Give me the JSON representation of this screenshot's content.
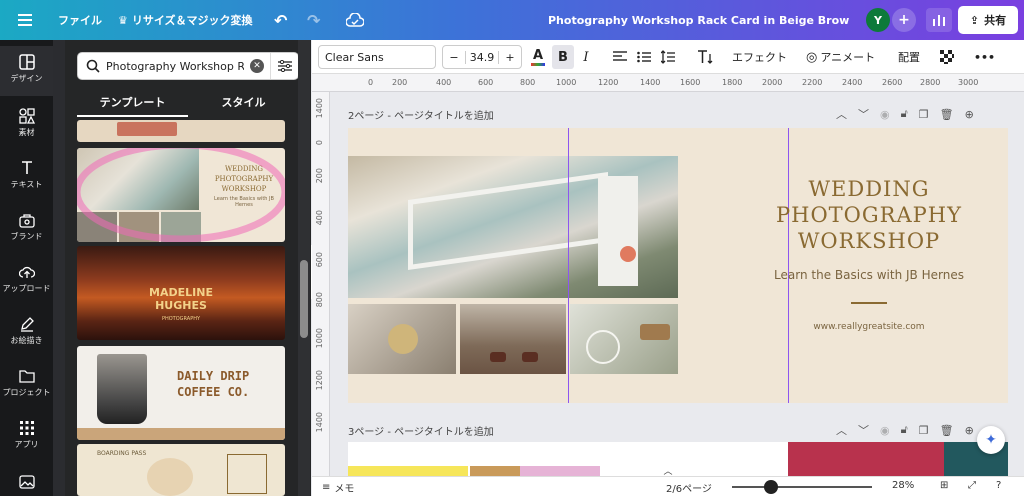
{
  "header": {
    "menu_icon": "hamburger-icon",
    "file": "ファイル",
    "resize": "リサイズ＆マジック変換",
    "doc_title": "Photography Workshop Rack Card in Beige Brown Photo Co...",
    "avatar": "Y",
    "share": "共有"
  },
  "rail": [
    {
      "label": "デザイン",
      "icon": "layout-icon",
      "active": true
    },
    {
      "label": "素材",
      "icon": "shapes-icon"
    },
    {
      "label": "テキスト",
      "icon": "text-icon"
    },
    {
      "label": "ブランド",
      "icon": "brand-icon"
    },
    {
      "label": "アップロード",
      "icon": "cloud-upload-icon"
    },
    {
      "label": "お絵描き",
      "icon": "pen-icon"
    },
    {
      "label": "プロジェクト",
      "icon": "folder-icon"
    },
    {
      "label": "アプリ",
      "icon": "apps-icon"
    }
  ],
  "panel": {
    "search_value": "Photography Workshop Rack",
    "tabs": [
      "テンプレート",
      "スタイル"
    ],
    "templates": {
      "t1_title": "WEDDING PHOTOGRAPHY WORKSHOP",
      "t1_sub": "Learn the Basics with JB Hernes",
      "t2_name_line1": "MADELINE",
      "t2_name_line2": "HUGHES",
      "t2_sub": "PHOTOGRAPHY",
      "t3_line1": "DAILY DRIP",
      "t3_line2": "COFFEE CO.",
      "t4_title": "BOARDING PASS"
    }
  },
  "toolbar": {
    "font": "Clear Sans",
    "size": "34.9",
    "minus": "−",
    "plus": "+",
    "text_color": "A",
    "bold": "B",
    "italic": "I",
    "effects": "エフェクト",
    "animate": "アニメート",
    "position": "配置",
    "more": "•••"
  },
  "ruler": {
    "top": [
      "0",
      "200",
      "400",
      "600",
      "800",
      "1000",
      "1200",
      "1400",
      "1600",
      "1800",
      "2000",
      "2200",
      "2400",
      "2600",
      "2800",
      "3000"
    ],
    "left": [
      "1400",
      "0",
      "200",
      "400",
      "600",
      "800",
      "1000",
      "1200",
      "1400"
    ]
  },
  "pages": {
    "p2_label": "2ページ - ページタイトルを追加",
    "p3_label": "3ページ - ページタイトルを追加"
  },
  "design": {
    "title_l1": "WEDDING",
    "title_l2": "PHOTOGRAPHY",
    "title_l3": "WORKSHOP",
    "subtitle": "Learn the Basics with JB Hernes",
    "url": "www.reallygreatsite.com",
    "title_color": "#8a6a32",
    "bg_color": "#f0e6d6"
  },
  "footer": {
    "notes": "メモ",
    "page_count": "2/6ページ",
    "zoom": "28%",
    "zoom_level": 0.28
  }
}
